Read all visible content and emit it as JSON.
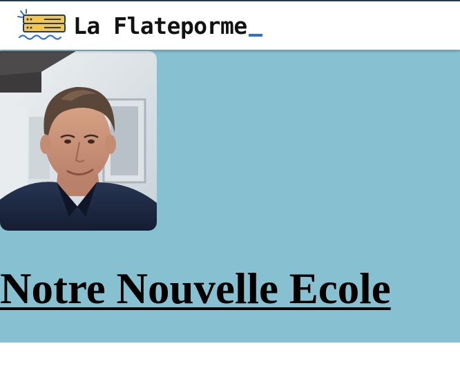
{
  "header": {
    "brand": "La Flateporme",
    "logo_icon": "server-rack-waves-icon",
    "cursor_color": "#2a6fd6"
  },
  "hero": {
    "background": "#87c1d1",
    "portrait_image": "portrait-photo",
    "title": "Notre Nouvelle Ecole"
  }
}
